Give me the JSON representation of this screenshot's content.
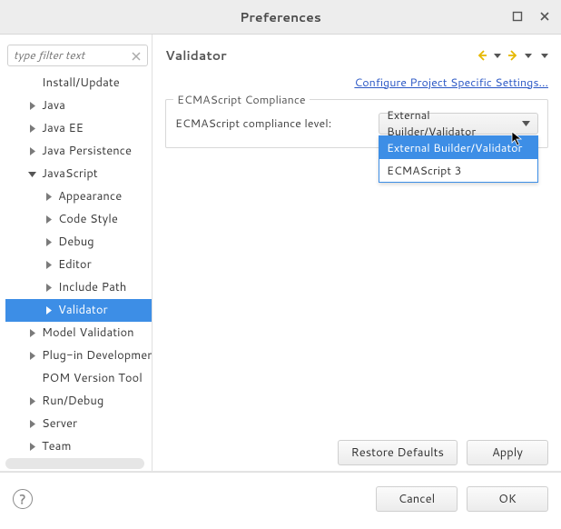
{
  "window": {
    "title": "Preferences"
  },
  "sidebar": {
    "filter_placeholder": "type filter text",
    "items": [
      {
        "label": "Install/Update",
        "depth": 1,
        "arrow": "none",
        "truncated": true
      },
      {
        "label": "Java",
        "depth": 1,
        "arrow": "closed"
      },
      {
        "label": "Java EE",
        "depth": 1,
        "arrow": "closed"
      },
      {
        "label": "Java Persistence",
        "depth": 1,
        "arrow": "closed"
      },
      {
        "label": "JavaScript",
        "depth": 1,
        "arrow": "open"
      },
      {
        "label": "Appearance",
        "depth": 2,
        "arrow": "closed"
      },
      {
        "label": "Code Style",
        "depth": 2,
        "arrow": "closed"
      },
      {
        "label": "Debug",
        "depth": 2,
        "arrow": "closed"
      },
      {
        "label": "Editor",
        "depth": 2,
        "arrow": "closed"
      },
      {
        "label": "Include Path",
        "depth": 2,
        "arrow": "closed"
      },
      {
        "label": "Validator",
        "depth": 2,
        "arrow": "closed",
        "selected": true
      },
      {
        "label": "Model Validation",
        "depth": 1,
        "arrow": "closed"
      },
      {
        "label": "Plug-in Development",
        "depth": 1,
        "arrow": "closed",
        "truncated": true
      },
      {
        "label": "POM Version Tool",
        "depth": 1,
        "arrow": "none"
      },
      {
        "label": "Run/Debug",
        "depth": 1,
        "arrow": "closed"
      },
      {
        "label": "Server",
        "depth": 1,
        "arrow": "closed"
      },
      {
        "label": "Team",
        "depth": 1,
        "arrow": "closed"
      }
    ]
  },
  "content": {
    "title": "Validator",
    "config_link": "Configure Project Specific Settings...",
    "fieldset_legend": "ECMAScript Compliance",
    "field_label": "ECMAScript compliance level:",
    "select_value": "External Builder/Validator",
    "select_options": [
      "External Builder/Validator",
      "ECMAScript 3"
    ],
    "restore_defaults": "Restore Defaults",
    "apply": "Apply"
  },
  "footer": {
    "cancel": "Cancel",
    "ok": "OK"
  }
}
